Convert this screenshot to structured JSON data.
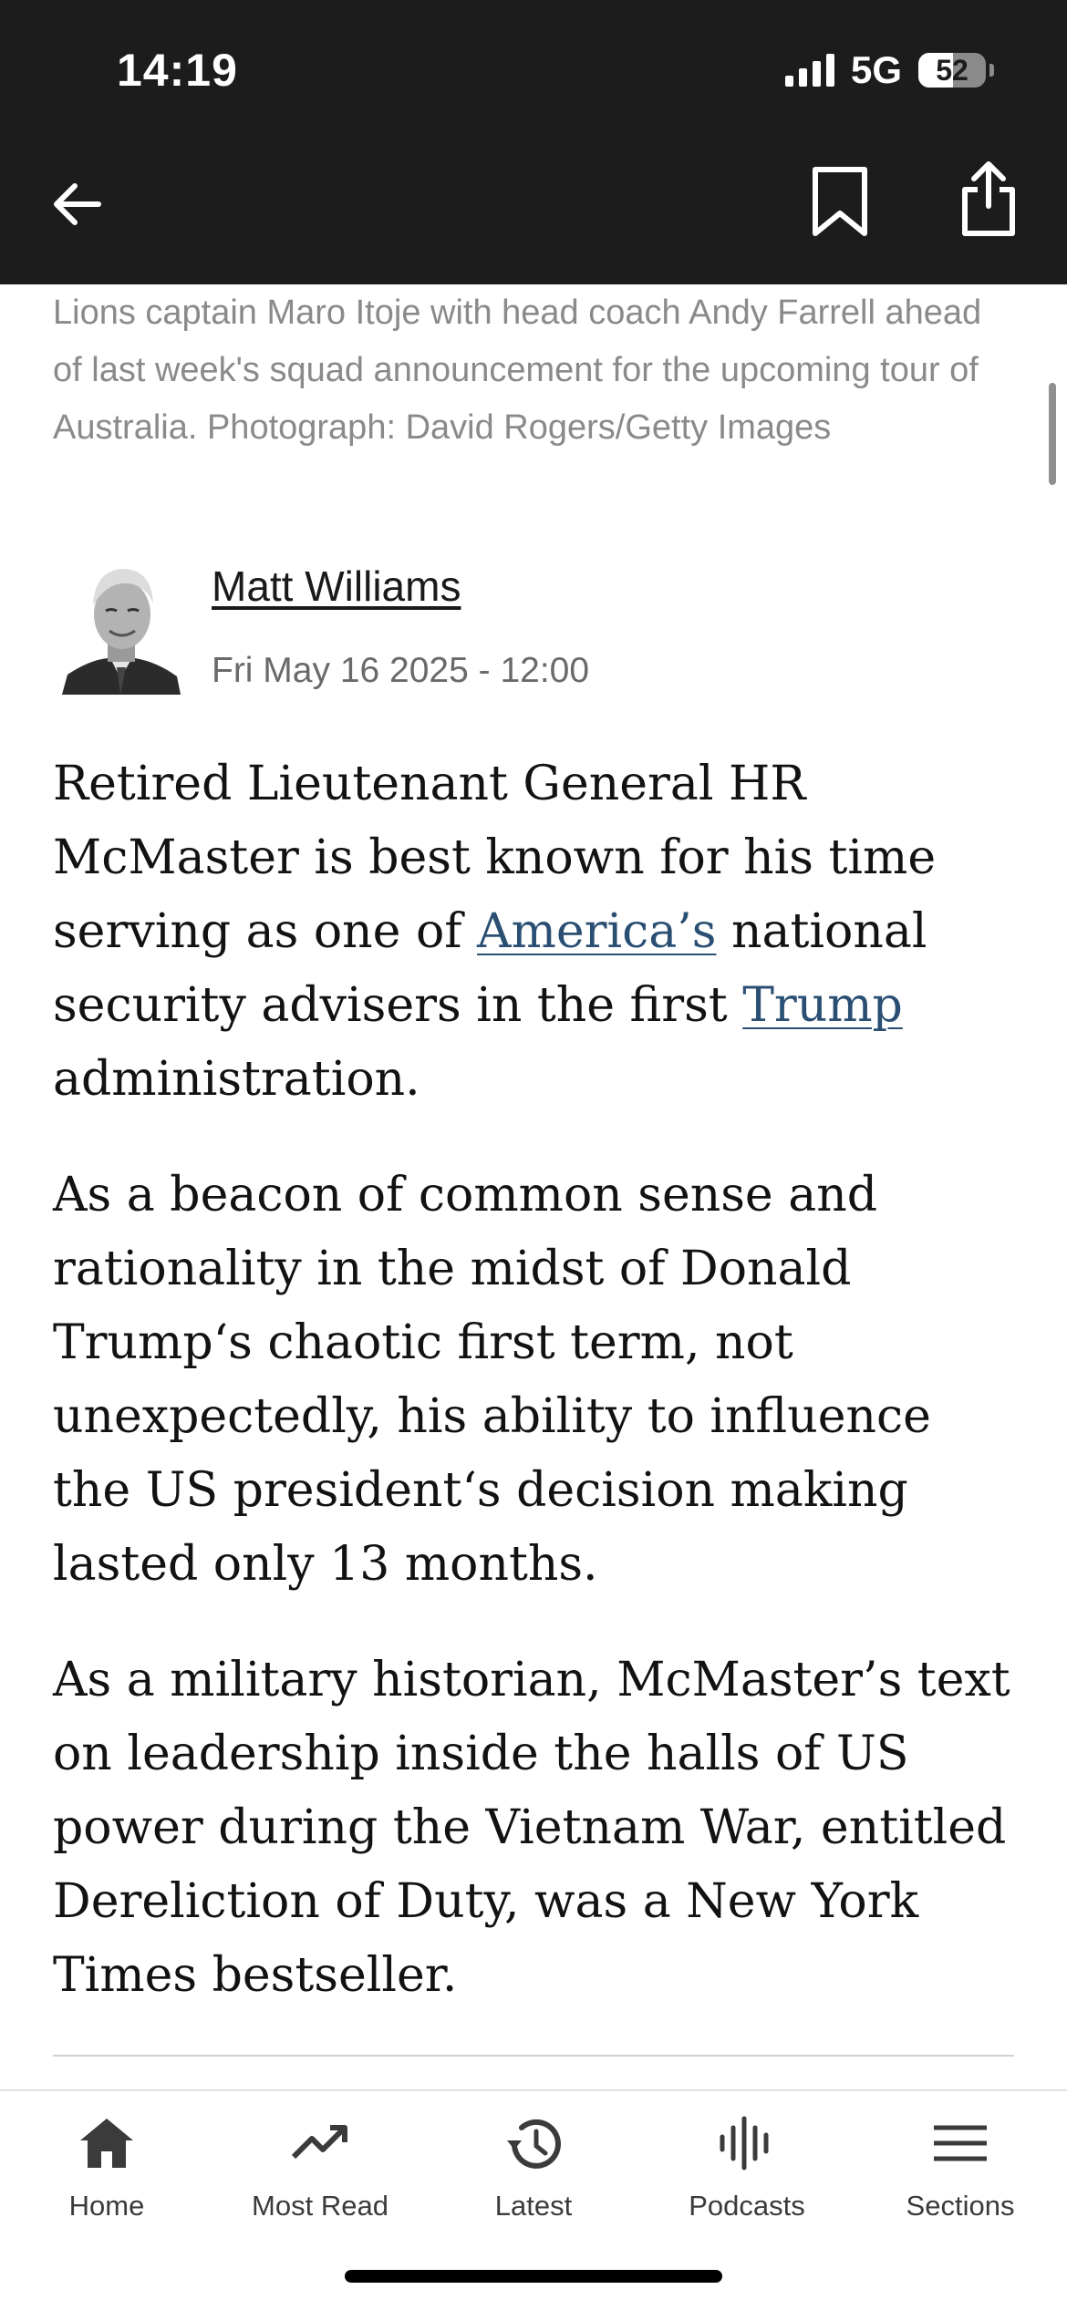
{
  "status_bar": {
    "time": "14:19",
    "network": "5G",
    "battery": "52",
    "battery_level": 0.52
  },
  "nav": {
    "back_icon": "arrow-left-icon",
    "bookmark_icon": "bookmark-icon",
    "share_icon": "share-icon"
  },
  "article": {
    "caption": "Lions captain Maro Itoje with head coach Andy Farrell ahead of last week's squad announcement for the upcoming tour of Australia. Photograph: David Rogers/Getty Images",
    "author": "Matt Williams",
    "date": "Fri May 16 2025 - 12:00",
    "p1": {
      "t1": "Retired Lieutenant General HR McMaster is best known for his time serving as one of ",
      "link1": "America’s",
      "t2": " national security advisers in the first ",
      "link2": "Trump",
      "t3": " administration."
    },
    "p2": "As a beacon of common sense and rationality in the midst of Donald Trump‘s chaotic first term, not unexpectedly, his ability to influence the US president‘s decision making lasted only 13 months.",
    "p3": "As a military historian, McMaster’s text on leadership inside the halls of US power during the Vietnam War, entitled Dereliction of Duty, was a New York Times bestseller.",
    "link_color": "#2a4f73"
  },
  "tabbar": {
    "items": [
      {
        "label": "Home",
        "icon": "home-icon"
      },
      {
        "label": "Most Read",
        "icon": "trending-icon"
      },
      {
        "label": "Latest",
        "icon": "history-icon"
      },
      {
        "label": "Podcasts",
        "icon": "podcast-icon"
      },
      {
        "label": "Sections",
        "icon": "menu-icon"
      }
    ]
  }
}
